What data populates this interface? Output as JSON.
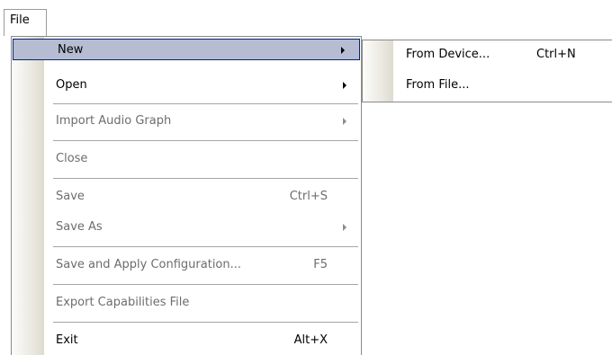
{
  "menubar": {
    "file_label": "File"
  },
  "file_menu": {
    "items": [
      {
        "label": "New",
        "shortcut": "",
        "submenu": true,
        "enabled": true,
        "highlighted": true
      },
      {
        "label": "Open",
        "shortcut": "",
        "submenu": true,
        "enabled": true
      },
      {
        "label": "Import Audio Graph",
        "shortcut": "",
        "submenu": true,
        "enabled": false
      },
      {
        "label": "Close",
        "shortcut": "",
        "submenu": false,
        "enabled": false
      },
      {
        "label": "Save",
        "shortcut": "Ctrl+S",
        "submenu": false,
        "enabled": false
      },
      {
        "label": "Save As",
        "shortcut": "",
        "submenu": true,
        "enabled": false
      },
      {
        "label": "Save and Apply Configuration...",
        "shortcut": "F5",
        "submenu": false,
        "enabled": false
      },
      {
        "label": "Export Capabilities File",
        "shortcut": "",
        "submenu": false,
        "enabled": false
      },
      {
        "label": "Exit",
        "shortcut": "Alt+X",
        "submenu": false,
        "enabled": true
      }
    ]
  },
  "new_submenu": {
    "items": [
      {
        "label": "From Device...",
        "shortcut": "Ctrl+N"
      },
      {
        "label": "From File...",
        "shortcut": ""
      }
    ]
  },
  "colors": {
    "highlight_bg": "#b6bdd2",
    "highlight_border": "#0a246a",
    "disabled_text": "#6d6d6d"
  }
}
